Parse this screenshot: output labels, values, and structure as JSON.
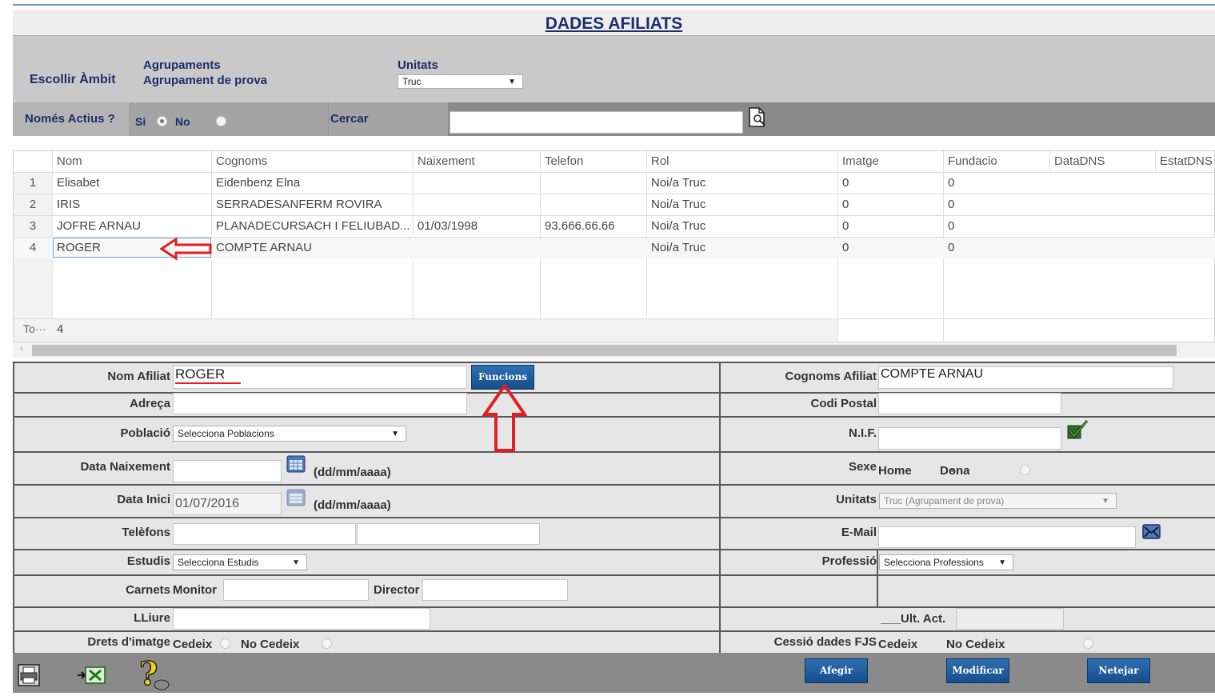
{
  "title": "DADES AFILIATS",
  "ambit": {
    "label": "Escollir Àmbit",
    "agrupaments_label": "Agrupaments",
    "agrupament_value": "Agrupament de prova",
    "unitats_label": "Unitats",
    "unitats_value": "Truc"
  },
  "filter": {
    "actius_label": "Només Actius ?",
    "si_label": "Si",
    "no_label": "No",
    "cercar_label": "Cercar",
    "cercar_value": ""
  },
  "grid": {
    "headers": [
      "Nom",
      "Cognoms",
      "Naixement",
      "Telefon",
      "Rol",
      "Imatge",
      "Fundacio",
      "DataDNS",
      "EstatDNS"
    ],
    "rows": [
      {
        "num": "1",
        "nom": "Elisabet",
        "cognoms": "Eidenbenz Elna",
        "naixement": "",
        "telefon": "",
        "rol": "Noi/a Truc",
        "imatge": "0",
        "fundacio": "0"
      },
      {
        "num": "2",
        "nom": "IRIS",
        "cognoms": "SERRADESANFERM ROVIRA",
        "naixement": "",
        "telefon": "",
        "rol": "Noi/a Truc",
        "imatge": "0",
        "fundacio": "0"
      },
      {
        "num": "3",
        "nom": "JOFRE ARNAU",
        "cognoms": "PLANADECURSACH I FELIUBAD...",
        "naixement": "01/03/1998",
        "telefon": "93.666.66.66",
        "rol": "Noi/a Truc",
        "imatge": "0",
        "fundacio": "0"
      },
      {
        "num": "4",
        "nom": "ROGER",
        "cognoms": "COMPTE ARNAU",
        "naixement": "",
        "telefon": "",
        "rol": "Noi/a Truc",
        "imatge": "0",
        "fundacio": "0"
      }
    ],
    "total_label": "To···",
    "total_value": "4"
  },
  "form": {
    "nom_label": "Nom Afiliat",
    "nom_value": "ROGER",
    "funcions_button": "Funcions",
    "cognoms_label": "Cognoms Afiliat",
    "cognoms_value": "COMPTE ARNAU",
    "adreca_label": "Adreça",
    "adreca_value": "",
    "codi_postal_label": "Codi Postal",
    "codi_postal_value": "",
    "poblacio_label": "Població",
    "poblacio_value": "Selecciona Poblacions",
    "nif_label": "N.I.F.",
    "nif_value": "",
    "data_naixement_label": "Data Naixement",
    "data_naixement_value": "",
    "date_format": "(dd/mm/aaaa)",
    "sexe_label": "Sexe",
    "home_label": "Home",
    "dona_label": "Dona",
    "data_inici_label": "Data Inici",
    "data_inici_value": "01/07/2016",
    "unitats_label": "Unitats",
    "unitats_value": "Truc (Agrupament de prova)",
    "telefons_label": "Telèfons",
    "telefon1_value": "",
    "telefon2_value": "",
    "email_label": "E-Mail",
    "email_value": "",
    "estudis_label": "Estudis",
    "estudis_value": "Selecciona Estudis",
    "professio_label": "Professió",
    "professio_value": "Selecciona Professions",
    "carnets_label": "Carnets",
    "monitor_label": "Monitor",
    "director_label": "Director",
    "lliure_label": "LLiure",
    "ult_act_label": "___Ult. Act.",
    "drets_label": "Drets d'imatge",
    "cedeix_label": "Cedeix",
    "no_cedeix_label": "No Cedeix",
    "cessio_label": "Cessió dades FJS"
  },
  "buttons": {
    "afegir": "Afegir",
    "modificar": "Modificar",
    "netejar": "Netejar"
  },
  "colors": {
    "title": "#1c2e6e",
    "button": "#1f5c9e",
    "annotation_arrow": "#e02020"
  }
}
